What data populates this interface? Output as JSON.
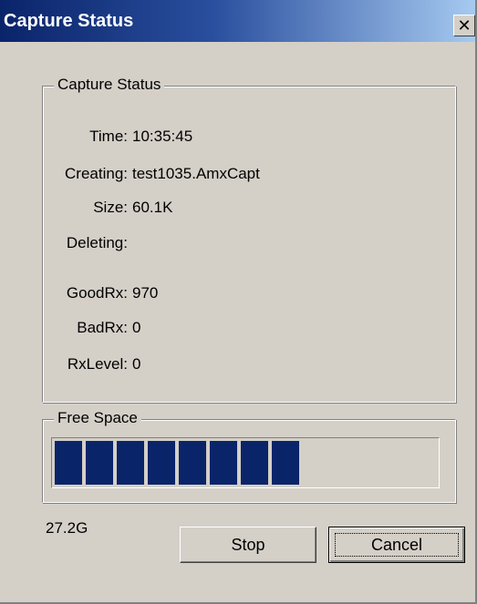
{
  "window": {
    "title": "Capture Status",
    "close_glyph": "✕"
  },
  "capture_status": {
    "legend": "Capture Status",
    "fields": [
      {
        "label": "Time:",
        "value": "10:35:45"
      },
      {
        "label": "Creating:",
        "value": "test1035.AmxCapt"
      },
      {
        "label": "Size:",
        "value": "60.1K"
      },
      {
        "label": "Deleting:",
        "value": ""
      },
      {
        "label": "GoodRx:",
        "value": "970"
      },
      {
        "label": "BadRx:",
        "value": "0"
      },
      {
        "label": "RxLevel:",
        "value": "0"
      }
    ]
  },
  "free_space": {
    "legend": "Free Space",
    "filled_blocks": 8,
    "total_blocks": 13,
    "value": "27.2G"
  },
  "buttons": {
    "stop": "Stop",
    "cancel": "Cancel"
  },
  "colors": {
    "progress_block": "#0a246a",
    "title_bar": "#0a246a"
  }
}
